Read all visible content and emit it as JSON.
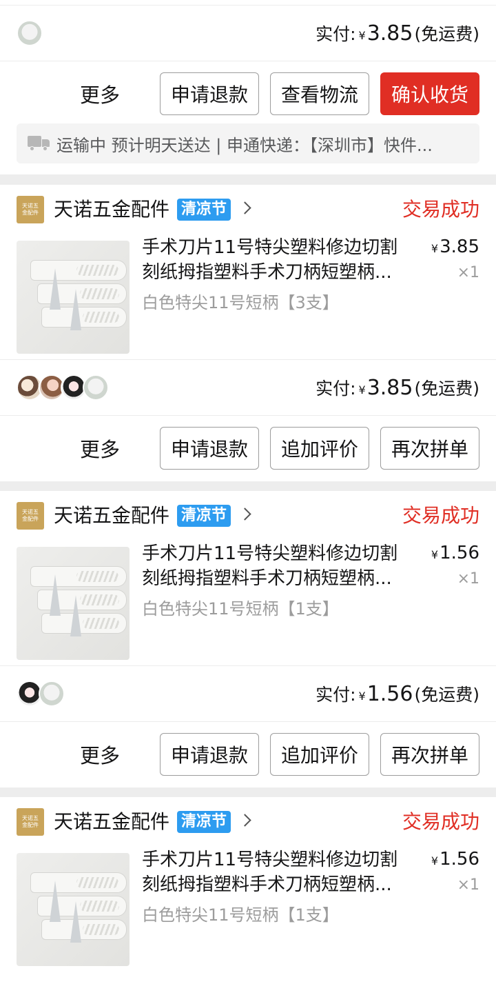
{
  "order0": {
    "pay_label": "实付:",
    "yen": "¥",
    "amount": "3.85",
    "shipping": "(免运费)",
    "more": "更多",
    "btn1": "申请退款",
    "btn2": "查看物流",
    "btn3": "确认收货",
    "logistics": "运输中 预计明天送达 | 申通快递：【深圳市】快件..."
  },
  "orders": [
    {
      "store_name": "天诺五金配件",
      "store_logo_text": "天诺五金配件",
      "badge": "清凉节",
      "status": "交易成功",
      "product_title_line1": "手术刀片11号特尖塑料修边切割",
      "product_title_line2": "刻纸拇指塑料手术刀柄短塑柄...",
      "spec": "白色特尖11号短柄【3支】",
      "yen": "¥",
      "price": "3.85",
      "qty": "×1",
      "pay_label": "实付:",
      "amount": "3.85",
      "shipping": "(免运费)",
      "more": "更多",
      "btn1": "申请退款",
      "btn2": "追加评价",
      "btn3": "再次拼单"
    },
    {
      "store_name": "天诺五金配件",
      "store_logo_text": "天诺五金配件",
      "badge": "清凉节",
      "status": "交易成功",
      "product_title_line1": "手术刀片11号特尖塑料修边切割",
      "product_title_line2": "刻纸拇指塑料手术刀柄短塑柄...",
      "spec": "白色特尖11号短柄【1支】",
      "yen": "¥",
      "price": "1.56",
      "qty": "×1",
      "pay_label": "实付:",
      "amount": "1.56",
      "shipping": "(免运费)",
      "more": "更多",
      "btn1": "申请退款",
      "btn2": "追加评价",
      "btn3": "再次拼单"
    },
    {
      "store_name": "天诺五金配件",
      "store_logo_text": "天诺五金配件",
      "badge": "清凉节",
      "status": "交易成功",
      "product_title_line1": "手术刀片11号特尖塑料修边切割",
      "product_title_line2": "刻纸拇指塑料手术刀柄短塑柄...",
      "spec": "白色特尖11号短柄【1支】",
      "yen": "¥",
      "price": "1.56",
      "qty": "×1"
    }
  ],
  "colors": {
    "accent_red": "#e02e24",
    "badge_blue": "#2d9cf0",
    "store_logo_gold": "#c9a45a"
  }
}
